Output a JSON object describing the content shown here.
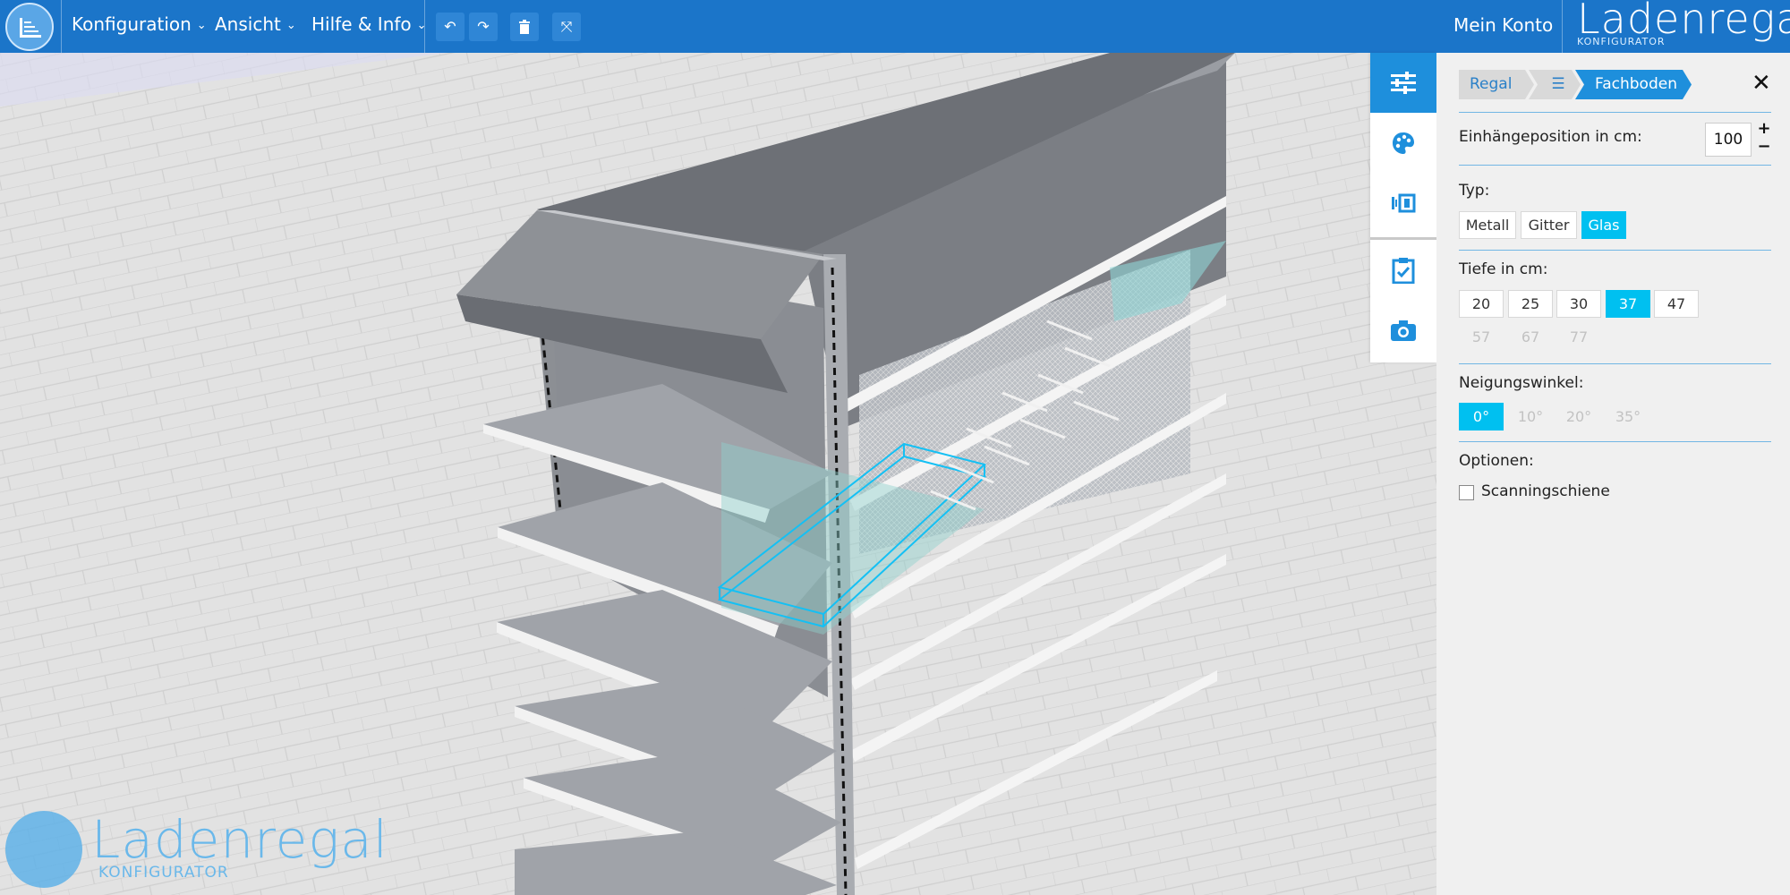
{
  "header": {
    "menu": [
      {
        "label": "Konfiguration",
        "chevron": "⌄"
      },
      {
        "label": "Ansicht",
        "chevron": "⌄"
      },
      {
        "label": "Hilfe & Info",
        "chevron": "⌄"
      }
    ],
    "tools": [
      {
        "icon": "undo-icon",
        "glyph": "↶"
      },
      {
        "icon": "redo-icon",
        "glyph": "↷"
      },
      {
        "icon": "trash-icon",
        "glyph": "🗑"
      },
      {
        "icon": "compress-icon",
        "glyph": "⤧"
      }
    ],
    "account_label": "Mein Konto",
    "brand_title": "Ladenregal",
    "brand_subtitle": "KONFIGURATOR"
  },
  "watermark": {
    "title": "Ladenregal",
    "subtitle": "KONFIGURATOR"
  },
  "sidebar": {
    "items": [
      {
        "icon": "sliders-icon",
        "active": true
      },
      {
        "icon": "palette-icon",
        "active": false
      },
      {
        "icon": "shelf-module-icon",
        "active": false
      },
      {
        "icon": "clipboard-check-icon",
        "active": false
      },
      {
        "icon": "camera-icon",
        "active": false
      }
    ]
  },
  "panel": {
    "breadcrumb": [
      {
        "label": "Regal"
      },
      {
        "label": "☰"
      },
      {
        "label": "Fachboden"
      }
    ],
    "close_glyph": "✕",
    "position": {
      "label": "Einhängeposition in cm:",
      "value": "100",
      "plus": "+",
      "minus": "−"
    },
    "type": {
      "label": "Typ:",
      "options": [
        "Metall",
        "Gitter",
        "Glas"
      ],
      "selected": "Glas"
    },
    "depth": {
      "label": "Tiefe in cm:",
      "options": [
        "20",
        "25",
        "30",
        "37",
        "47",
        "57",
        "67",
        "77"
      ],
      "selected": "37",
      "disabled": [
        "57",
        "67",
        "77"
      ]
    },
    "tilt": {
      "label": "Neigungswinkel:",
      "options": [
        "0°",
        "10°",
        "20°",
        "35°"
      ],
      "selected": "0°",
      "disabled": [
        "10°",
        "20°",
        "35°"
      ]
    },
    "options": {
      "label": "Optionen:",
      "scanning_label": "Scanningschiene",
      "scanning_checked": false
    }
  },
  "colors": {
    "topbar": "#1b75c9",
    "accent": "#1e8fdc",
    "selected": "#00c0f0",
    "panel_bg": "#f0f0f0"
  }
}
